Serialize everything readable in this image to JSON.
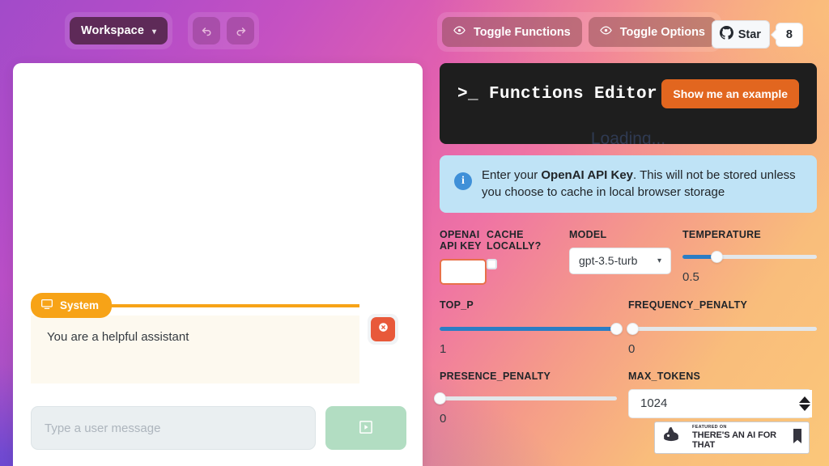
{
  "header": {
    "workspace_button": "Workspace",
    "workspace_chevron": "chevron-down-icon",
    "undo_icon": "undo-icon",
    "redo_icon": "redo-icon",
    "toggle_functions": "Toggle Functions",
    "toggle_options": "Toggle Options",
    "eye_icon": "eye-icon",
    "github": {
      "star_label": "Star",
      "count": "8",
      "icon": "github-icon"
    }
  },
  "chat": {
    "message": {
      "role_label": "System",
      "role_icon": "monitor-icon",
      "content": "You are a helpful assistant",
      "delete_icon": "close-circle-icon"
    },
    "composer": {
      "placeholder": "Type a user message",
      "value": "",
      "send_icon": "play-box-icon"
    }
  },
  "functions_editor": {
    "prompt_glyph": ">_",
    "title": "Functions Editor",
    "example_button": "Show me an example",
    "loading_text": "Loading..."
  },
  "info_banner": {
    "icon": "info-icon",
    "text_before": "Enter your ",
    "text_bold": "OpenAI API Key",
    "text_after": ". This will not be stored unless you choose to cache in local browser storage"
  },
  "options": {
    "openai_api_key": {
      "label": "OPENAI API KEY",
      "value": "",
      "error": true
    },
    "cache_locally": {
      "label": "CACHE LOCALLY?",
      "checked": false
    },
    "model": {
      "label": "MODEL",
      "selected": "gpt-3.5-turb",
      "chevron": "chevron-down-icon"
    },
    "temperature": {
      "label": "TEMPERATURE",
      "value": "0.5",
      "percent": 25
    },
    "top_p": {
      "label": "TOP_P",
      "value": "1",
      "percent": 97
    },
    "frequency_penalty": {
      "label": "FREQUENCY_PENALTY",
      "value": "0",
      "percent": 2
    },
    "presence_penalty": {
      "label": "PRESENCE_PENALTY",
      "value": "0",
      "percent": 0
    },
    "max_tokens": {
      "label": "MAX_TOKENS",
      "value": "1024"
    }
  },
  "taaft_badge": {
    "featured_on": "FEATURED ON",
    "name": "THERE'S AN AI FOR THAT",
    "logo_icon": "taaft-logo-icon",
    "bookmark_icon": "bookmark-icon"
  },
  "colors": {
    "accent_orange": "#e2661f",
    "slider_blue": "#2b7dc4",
    "system_badge": "#f7a317",
    "delete_red": "#e8593a",
    "send_green": "#b2ddc2",
    "info_blue": "#bfe3f6",
    "error_border": "#e8704a"
  }
}
